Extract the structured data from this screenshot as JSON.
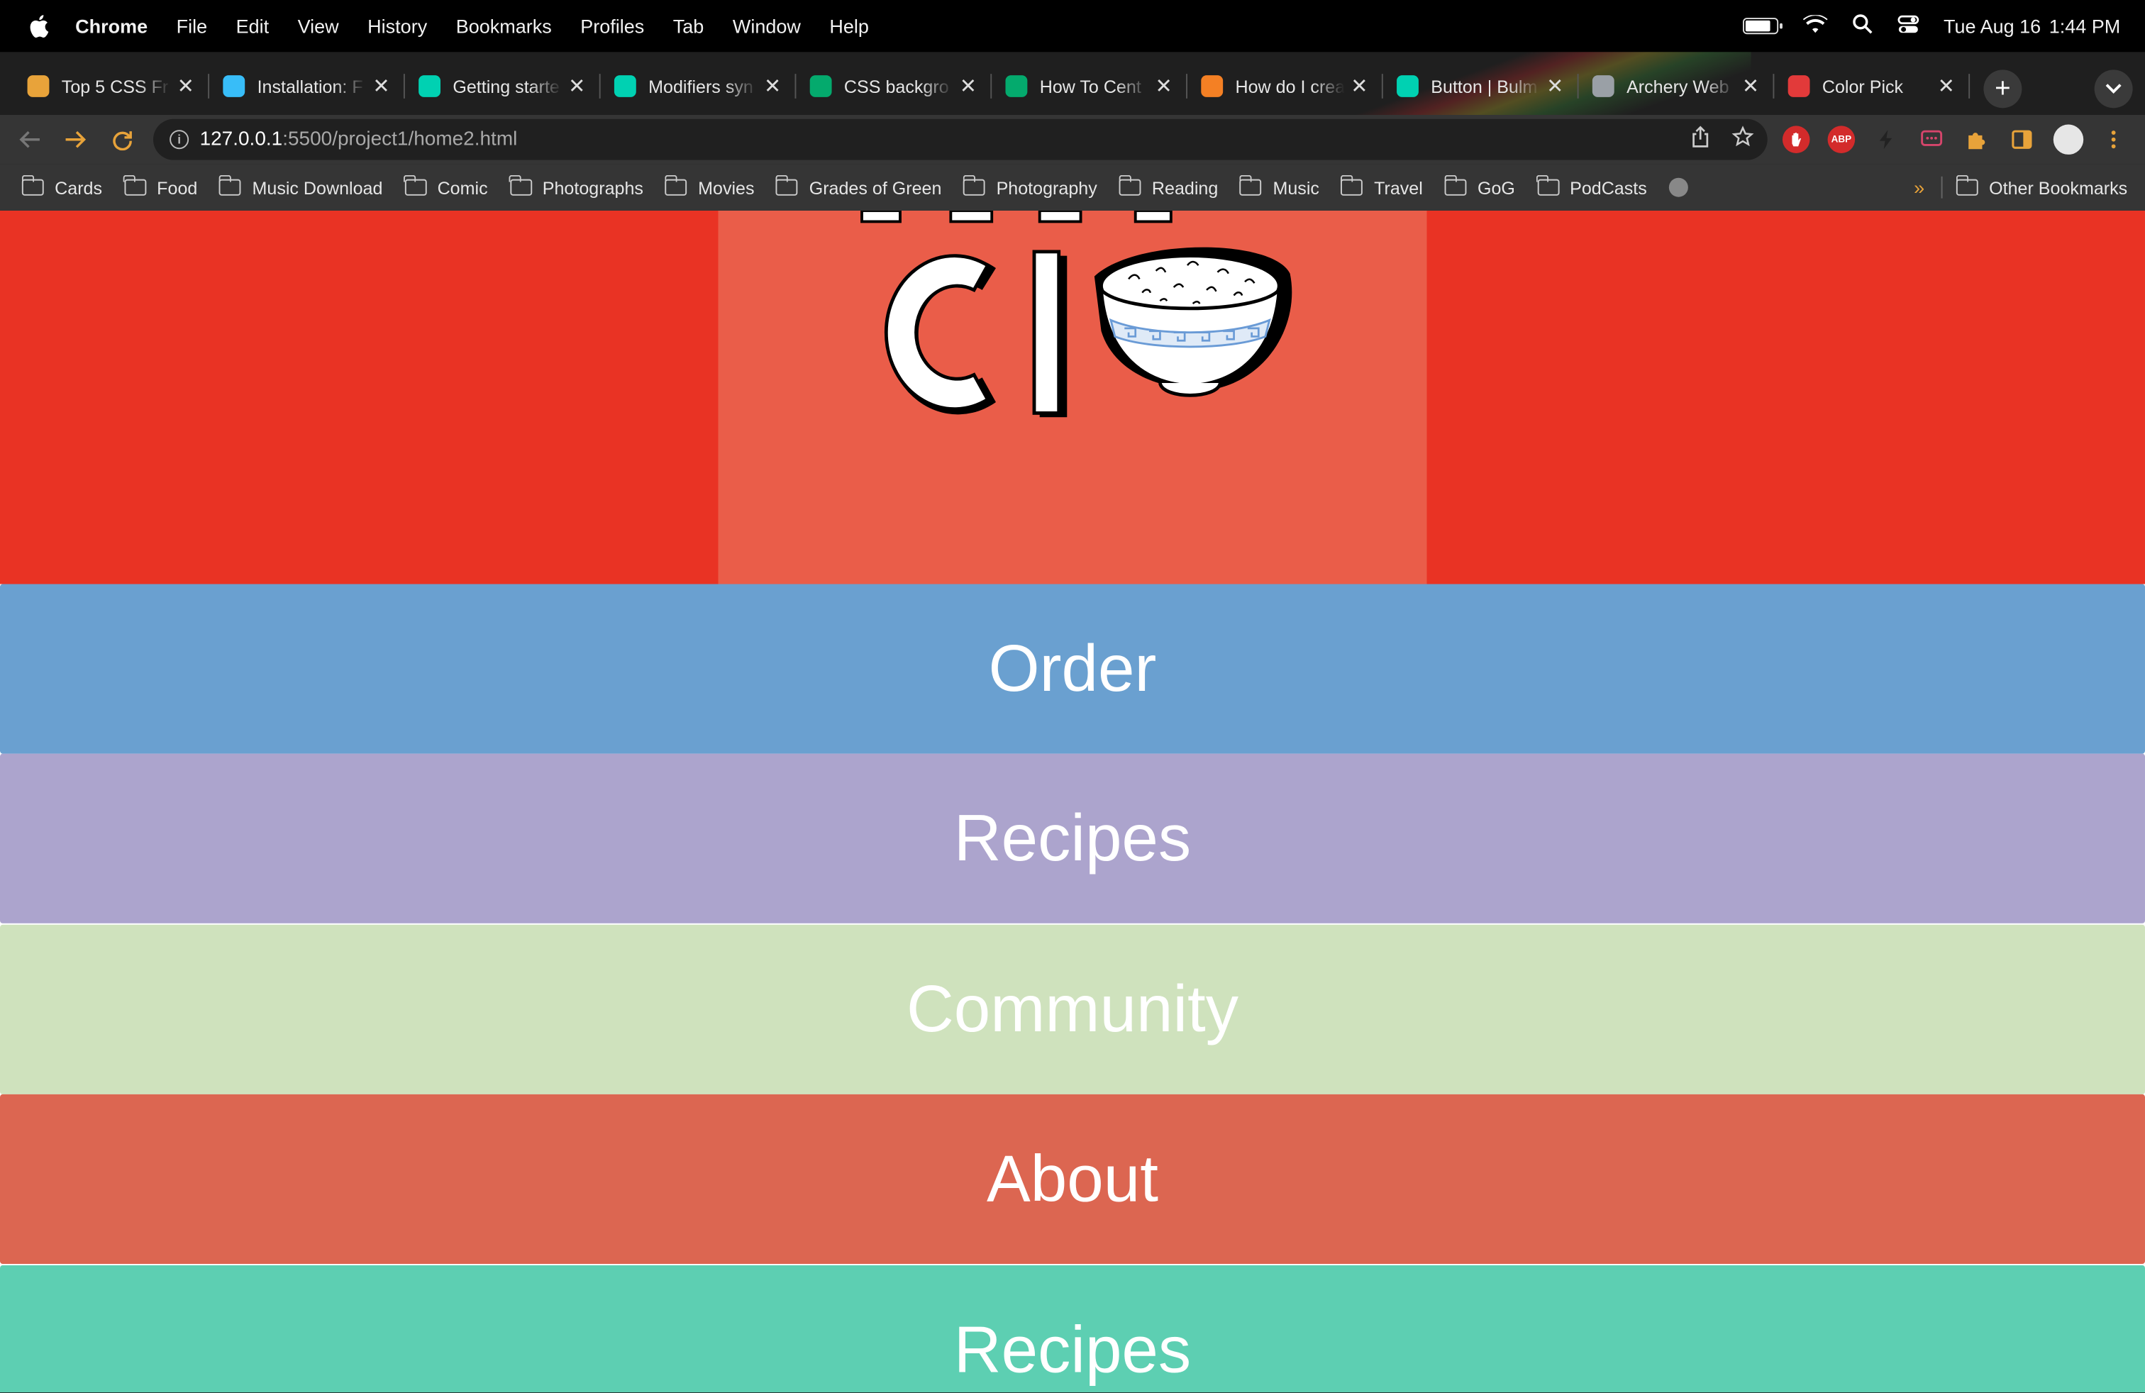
{
  "menubar": {
    "app": "Chrome",
    "items": [
      "File",
      "Edit",
      "View",
      "History",
      "Bookmarks",
      "Profiles",
      "Tab",
      "Window",
      "Help"
    ],
    "date": "Tue Aug 16",
    "time": "1:44 PM",
    "battery_level": 0.8
  },
  "tabs": [
    {
      "label": "Top 5 CSS Fr",
      "icon": "chrome-icon",
      "color": "#e8a33a"
    },
    {
      "label": "Installation: F",
      "icon": "tailwind-icon",
      "color": "#38bdf8"
    },
    {
      "label": "Getting starte",
      "icon": "bulma-icon",
      "color": "#00d1b2"
    },
    {
      "label": "Modifiers syn",
      "icon": "bulma-icon",
      "color": "#00d1b2"
    },
    {
      "label": "CSS backgro",
      "icon": "w3schools-icon",
      "color": "#04aa6d"
    },
    {
      "label": "How To Cent",
      "icon": "w3schools-icon",
      "color": "#04aa6d"
    },
    {
      "label": "How do I crea",
      "icon": "stackoverflow-icon",
      "color": "#f48024"
    },
    {
      "label": "Button | Bulm",
      "icon": "bulma-icon",
      "color": "#00d1b2"
    },
    {
      "label": "Archery Web",
      "icon": "globe-icon",
      "color": "#9aa0a6"
    },
    {
      "label": "Color Pick",
      "icon": "color-picker-icon",
      "color": "#e23a3a"
    }
  ],
  "url": {
    "host": "127.0.0.1",
    "path": ":5500/project1/home2.html"
  },
  "bookmarks": [
    "Cards",
    "Food",
    "Music Download",
    "Comic",
    "Photographs",
    "Movies",
    "Grades of Green",
    "Photography",
    "Reading",
    "Music",
    "Travel",
    "GoG",
    "PodCasts"
  ],
  "bookmarks_more": "»",
  "bookmarks_other": "Other Bookmarks",
  "extensions": {
    "abp": "ABP"
  },
  "page": {
    "hero_colors": {
      "outer": "#e93324",
      "center": "#ea5d49"
    },
    "logo_letters": "CI",
    "nav": [
      {
        "label": "Order",
        "color": "#6aa0d0"
      },
      {
        "label": "Recipes",
        "color": "#aca4cd"
      },
      {
        "label": "Community",
        "color": "#cfe2bd"
      },
      {
        "label": "About",
        "color": "#dc6651"
      },
      {
        "label": "Recipes",
        "color": "#5dcfb2"
      }
    ]
  }
}
